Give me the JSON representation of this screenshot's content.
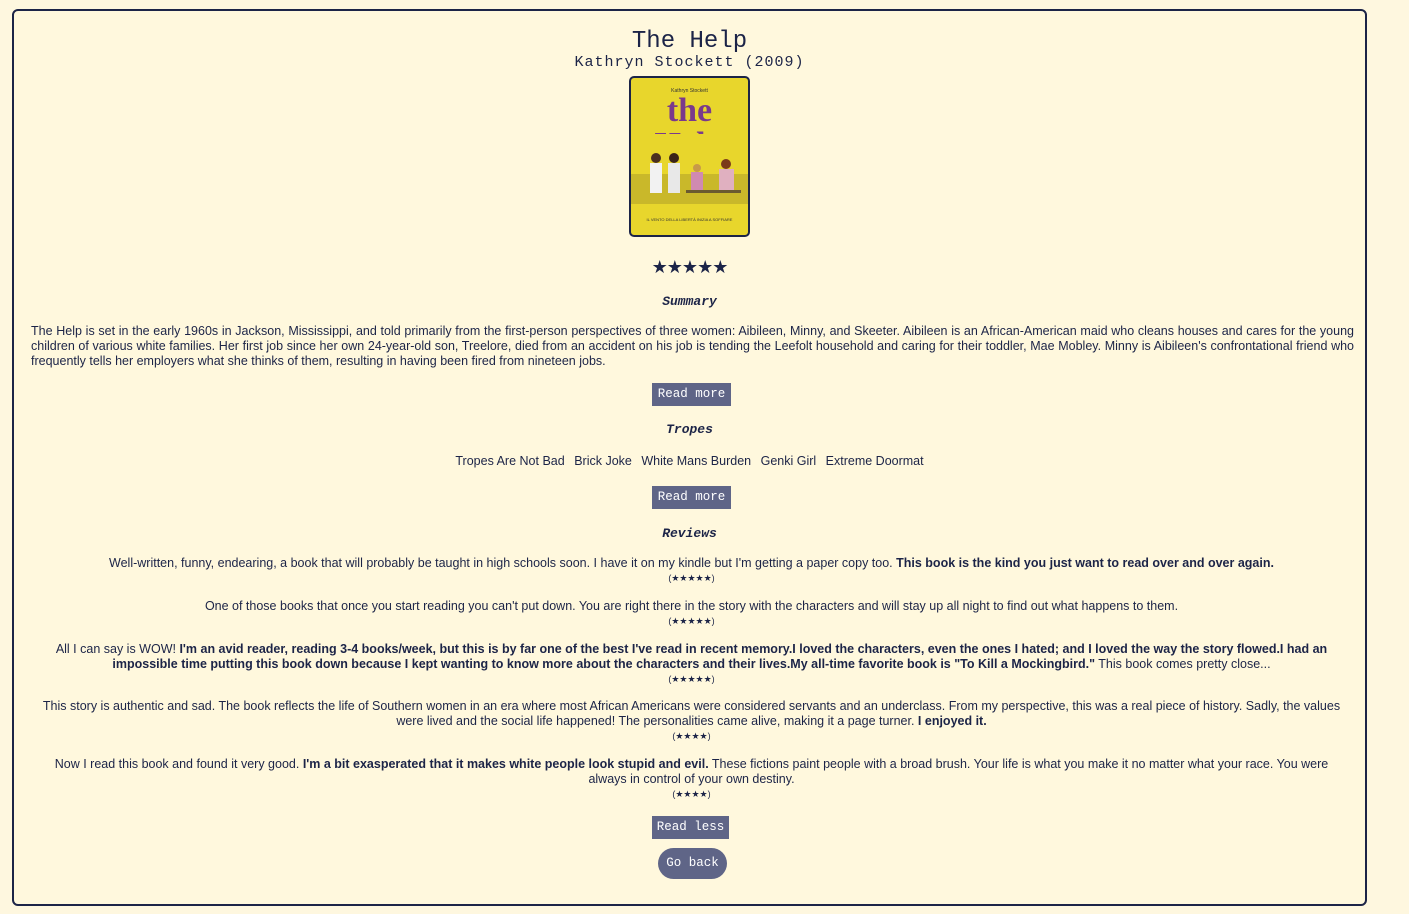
{
  "book": {
    "title": "The Help",
    "subtitle": "Kathryn Stockett (2009)",
    "cover_author": "Kathryn Stockett",
    "cover_title": "the Help",
    "cover_tagline": "IL VENTO DELLA LIBERTÀ INIZIA A SOFFIARE",
    "rating": "★★★★★",
    "rating_value": 4.5
  },
  "summary": {
    "heading": "Summary",
    "text": "The Help is set in the early 1960s in Jackson, Mississippi, and told primarily from the first-person perspectives of three women: Aibileen, Minny, and Skeeter. Aibileen is an African-American maid who cleans houses and cares for the young children of various white families. Her first job since her own 24-year-old son, Treelore, died from an accident on his job is tending the Leefolt household and caring for their toddler, Mae Mobley. Minny is Aibileen's confrontational friend who frequently tells her employers what she thinks of them, resulting in having been fired from nineteen jobs.",
    "button": "Read more"
  },
  "tropes": {
    "heading": "Tropes",
    "items": [
      "Tropes Are Not Bad",
      "Brick Joke",
      "White Mans Burden",
      "Genki Girl",
      "Extreme Doormat"
    ],
    "button": "Read more"
  },
  "reviews": {
    "heading": "Reviews",
    "items": [
      {
        "plain": "Well-written, funny, endearing, a book that will probably be taught in high schools soon. I have it on my kindle but I'm getting a paper copy too. ",
        "bold": "This book is the kind you just want to read over and over again.",
        "tail": "",
        "stars": "(★★★★★)"
      },
      {
        "plain": "One of those books that once you start reading you can't put down. You are right there in the story with the characters and will stay up all night to find out what happens to them.",
        "bold": "",
        "tail": "",
        "stars": "(★★★★★)"
      },
      {
        "plain": "All I can say is WOW! ",
        "bold": "I'm an avid reader, reading 3-4 books/week, but this is by far one of the best I've read in recent memory.I loved the characters, even the ones I hated; and I loved the way the story flowed.I had an impossible time putting this book down because I kept wanting to know more about the characters and their lives.My all-time favorite book is \"To Kill a Mockingbird.\"",
        "tail": " This book comes pretty close...",
        "stars": "(★★★★★)"
      },
      {
        "plain": "This story is authentic and sad. The book reflects the life of Southern women in an era where most African Americans were considered servants and an underclass. From my perspective, this was a real piece of history. Sadly, the values were lived and the social life happened! The personalities came alive, making it a page turner. ",
        "bold": "I enjoyed it.",
        "tail": "",
        "stars": "(★★★★)"
      },
      {
        "plain": "Now I read this book and found it very good. ",
        "bold": "I'm a bit exasperated that it makes white people look stupid and evil.",
        "tail": " These fictions paint people with a broad brush. Your life is what you make it no matter what your race. You were always in control of your own destiny.",
        "stars": "(★★★★)"
      }
    ],
    "button": "Read less"
  },
  "go_back": "Go back",
  "colors": {
    "background": "#fef7df",
    "text": "#1c2447",
    "button": "#5f6587",
    "cover": "#e8d62c"
  }
}
